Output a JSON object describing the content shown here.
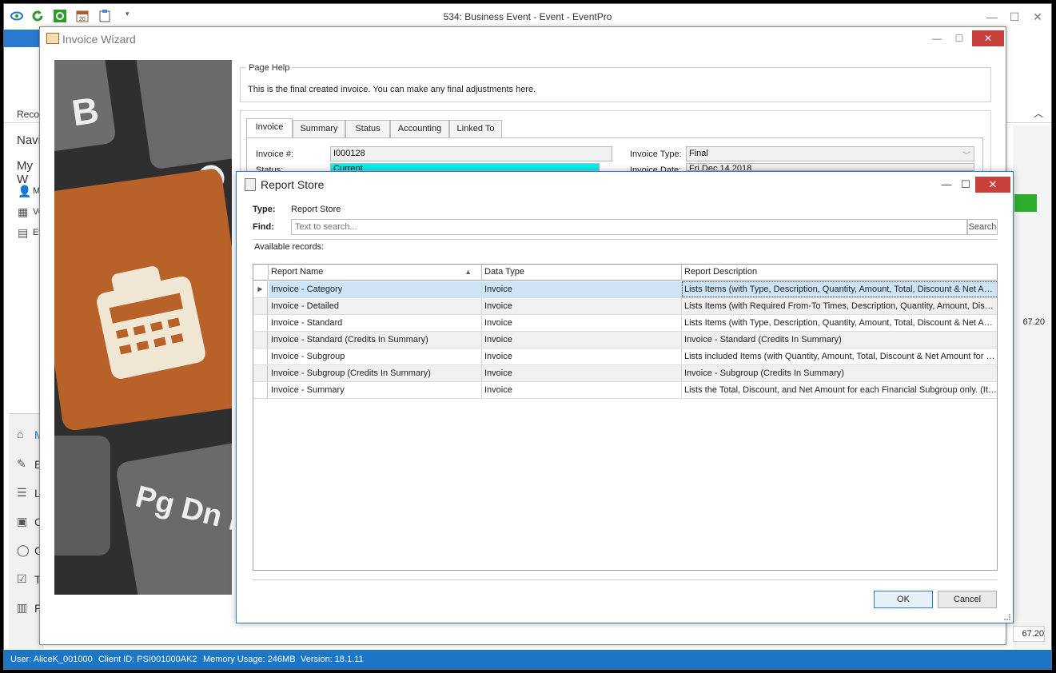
{
  "app": {
    "title": "534: Business Event - Event - EventPro",
    "record_tab": "Recor",
    "nav_title": "Navig",
    "nav_section": "My W",
    "nav_items": [
      "My",
      "Ve",
      "Ev"
    ],
    "nav_bottom": [
      "M",
      "E",
      "L",
      "C",
      "C",
      "T",
      "F"
    ],
    "side_value_1": "67.20",
    "side_value_2": "67.20"
  },
  "status_bar": {
    "user": "User: AliceK_001000",
    "client": "Client ID: PSI001000AK2",
    "memory": "Memory Usage: 246MB",
    "version": "Version: 18.1.11"
  },
  "wizard": {
    "title": "Invoice Wizard",
    "page_help_label": "Page Help",
    "page_help_text": "This is the final created invoice.  You can make any final adjustments here.",
    "tabs": [
      "Invoice",
      "Summary",
      "Status",
      "Accounting",
      "Linked To"
    ],
    "fields": {
      "invoice_no_label": "Invoice #:",
      "invoice_no": "I000128",
      "invoice_type_label": "Invoice Type:",
      "invoice_type": "Final",
      "status_label": "Status:",
      "status": "Current",
      "invoice_date_label": "Invoice Date:",
      "invoice_date": "Fri Dec 14 2018"
    }
  },
  "dialog": {
    "title": "Report Store",
    "type_label": "Type:",
    "type_value": "Report Store",
    "find_label": "Find:",
    "find_placeholder": "Text to search...",
    "search_button": "Search",
    "available_label": "Available records:",
    "columns": [
      "Report Name",
      "Data Type",
      "Report Description"
    ],
    "rows": [
      {
        "name": "Invoice - Category",
        "type": "Invoice",
        "desc": "Lists Items (with Type, Description, Quantity, Amount, Total, Discount & Net Amount) grouped by Category"
      },
      {
        "name": "Invoice - Detailed",
        "type": "Invoice",
        "desc": "Lists Items (with Required From-To Times, Description, Quantity, Amount, Discount & Net Amount)"
      },
      {
        "name": "Invoice - Standard",
        "type": "Invoice",
        "desc": "Lists Items (with Type, Description, Quantity, Amount, Total, Discount & Net Amount)"
      },
      {
        "name": "Invoice - Standard (Credits In Summary)",
        "type": "Invoice",
        "desc": "Invoice - Standard (Credits In Summary)"
      },
      {
        "name": "Invoice - Subgroup",
        "type": "Invoice",
        "desc": "Lists included Items (with Quantity, Amount, Total, Discount & Net Amount for each Subgroup)"
      },
      {
        "name": "Invoice - Subgroup (Credits In Summary)",
        "type": "Invoice",
        "desc": "Invoice - Subgroup (Credits In Summary)"
      },
      {
        "name": "Invoice - Summary",
        "type": "Invoice",
        "desc": "Lists the Total, Discount, and Net Amount for each Financial Subgroup only. (Items not listed)"
      }
    ],
    "ok_button": "OK",
    "cancel_button": "Cancel"
  },
  "colors": {
    "accent": "#1c76c6",
    "close_red": "#c8403a",
    "selected_row": "#cde4f7",
    "status_cyan": "#00f0f0",
    "key_orange": "#b8622a"
  }
}
